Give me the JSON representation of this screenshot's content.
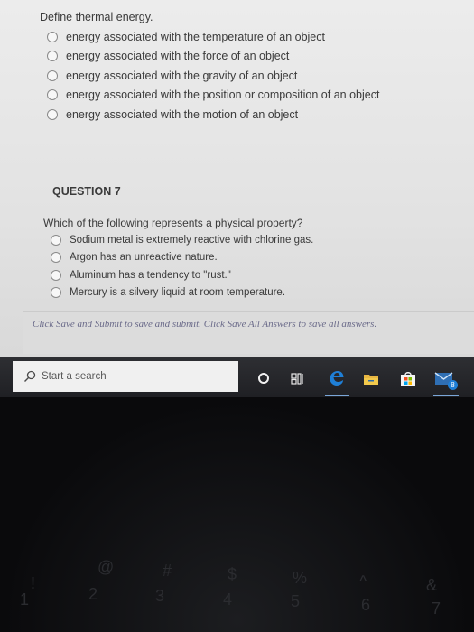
{
  "question6": {
    "prompt": "Define thermal energy.",
    "options": [
      "energy associated with the temperature of an object",
      "energy associated with the force of an object",
      "energy associated with the gravity of an object",
      "energy associated with the position or composition of an object",
      "energy associated with the motion of an object"
    ]
  },
  "question7": {
    "header": "QUESTION 7",
    "prompt": "Which of the following represents a physical property?",
    "options": [
      "Sodium metal is extremely reactive with chlorine gas.",
      "Argon has an unreactive nature.",
      "Aluminum has a tendency to \"rust.\"",
      "Mercury is a silvery liquid at room temperature."
    ]
  },
  "footer": {
    "note": "Click Save and Submit to save and submit. Click Save All Answers to save all answers."
  },
  "taskbar": {
    "search_placeholder": "Start a search",
    "mail_badge": "8",
    "icons": [
      "search-icon",
      "cortana-icon",
      "task-view-icon",
      "edge-icon",
      "file-explorer-icon",
      "store-icon",
      "mail-icon"
    ]
  },
  "keyboard": {
    "keys": [
      "!",
      "1",
      "@",
      "2",
      "#",
      "3",
      "$",
      "4",
      "%",
      "5",
      "^",
      "6",
      "&",
      "7"
    ]
  },
  "colors": {
    "page_bg": "#e6e6e6",
    "taskbar_bg": "#25262a",
    "edge_blue": "#1f7fd6",
    "accent_underline": "#7aa6d8"
  }
}
